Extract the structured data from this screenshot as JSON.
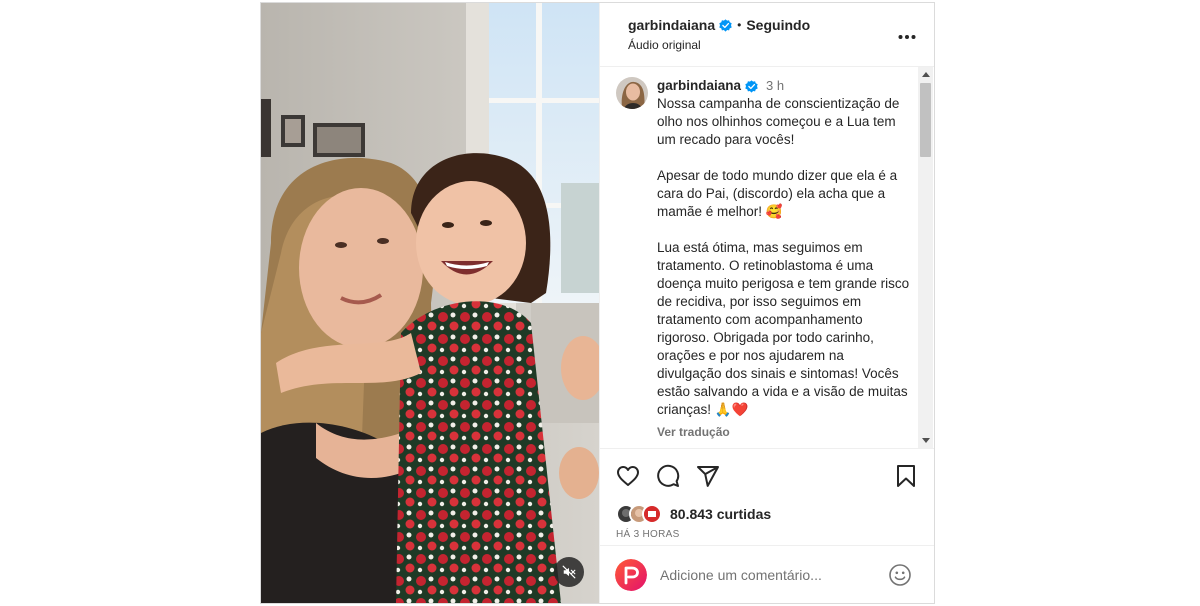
{
  "header": {
    "username": "garbindaiana",
    "separator": "•",
    "follow_label": "Seguindo",
    "audio_label": "Áudio original"
  },
  "caption": {
    "username": "garbindaiana",
    "time": "3 h",
    "paragraphs": [
      "Nossa campanha de conscientização de olho nos olhinhos começou e a Lua tem um recado para vocês!",
      "Apesar de todo mundo dizer que ela é a cara do Pai, (discordo) ela acha que a mamãe é melhor! 🥰",
      "Lua está ótima, mas seguimos em tratamento. O retinoblastoma é uma doença muito perigosa e tem grande risco de recidiva, por isso seguimos em tratamento com acompanhamento rigoroso. Obrigada por todo carinho, orações e por nos ajudarem na divulgação dos sinais e sintomas! Vocês estão salvando a vida e a visão de muitas crianças! 🙏❤️"
    ],
    "see_translation": "Ver tradução"
  },
  "actions": {
    "like_icon": "heart-icon",
    "comment_icon": "comment-icon",
    "share_icon": "share-icon",
    "save_icon": "bookmark-icon"
  },
  "likes": {
    "count_label": "80.843 curtidas"
  },
  "time_ago": "HÁ 3 HORAS",
  "comment": {
    "placeholder": "Adicione um comentário..."
  },
  "media": {
    "mute_icon": "speaker-muted-icon"
  },
  "colors": {
    "verified": "#0095f6",
    "text": "#262626",
    "secondary": "#737373"
  }
}
